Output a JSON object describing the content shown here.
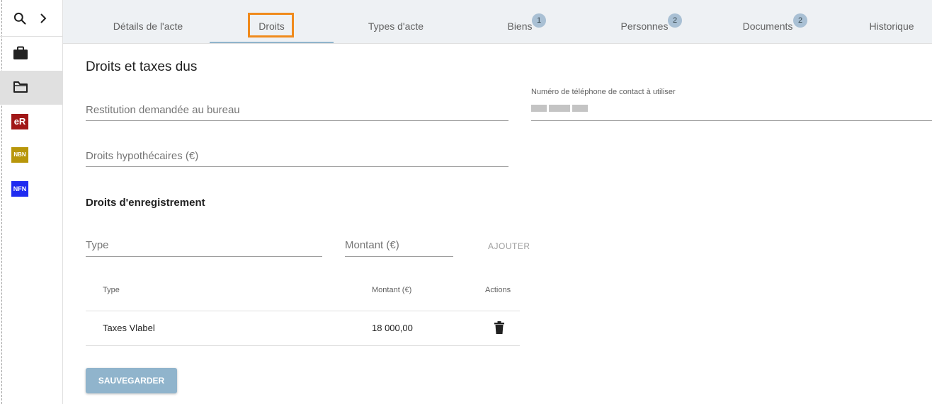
{
  "sidebar": {
    "items": [
      {
        "name": "briefcase-icon"
      },
      {
        "name": "folder-icon",
        "active": true
      },
      {
        "label": "eR",
        "color": "#a11818"
      },
      {
        "label": "NBN",
        "color": "#b8960a"
      },
      {
        "label": "NFN",
        "color": "#1f2bf0"
      }
    ]
  },
  "tabs": [
    {
      "label": "Détails de l'acte"
    },
    {
      "label": "Droits",
      "active": true
    },
    {
      "label": "Types d'acte"
    },
    {
      "label": "Biens",
      "count": "1"
    },
    {
      "label": "Personnes",
      "count": "2"
    },
    {
      "label": "Documents",
      "count": "2"
    },
    {
      "label": "Historique"
    }
  ],
  "main": {
    "title": "Droits et taxes dus",
    "restitution_placeholder": "Restitution demandée au bureau",
    "phone_label": "Numéro de téléphone de contact à utiliser",
    "mortgage_placeholder": "Droits hypothécaires (€)",
    "registration_title": "Droits d'enregistrement",
    "type_placeholder": "Type",
    "amount_placeholder": "Montant (€)",
    "add_label": "AJOUTER",
    "table": {
      "headers": [
        "Type",
        "Montant (€)",
        "Actions"
      ],
      "rows": [
        {
          "type": "Taxes Vlabel",
          "amount": "18 000,00"
        }
      ]
    },
    "save_label": "SAUVEGARDER"
  },
  "colors": {
    "accent": "#90b4cc",
    "tab_highlight": "#f08a1c",
    "badge_bg": "#a9c0d4"
  }
}
